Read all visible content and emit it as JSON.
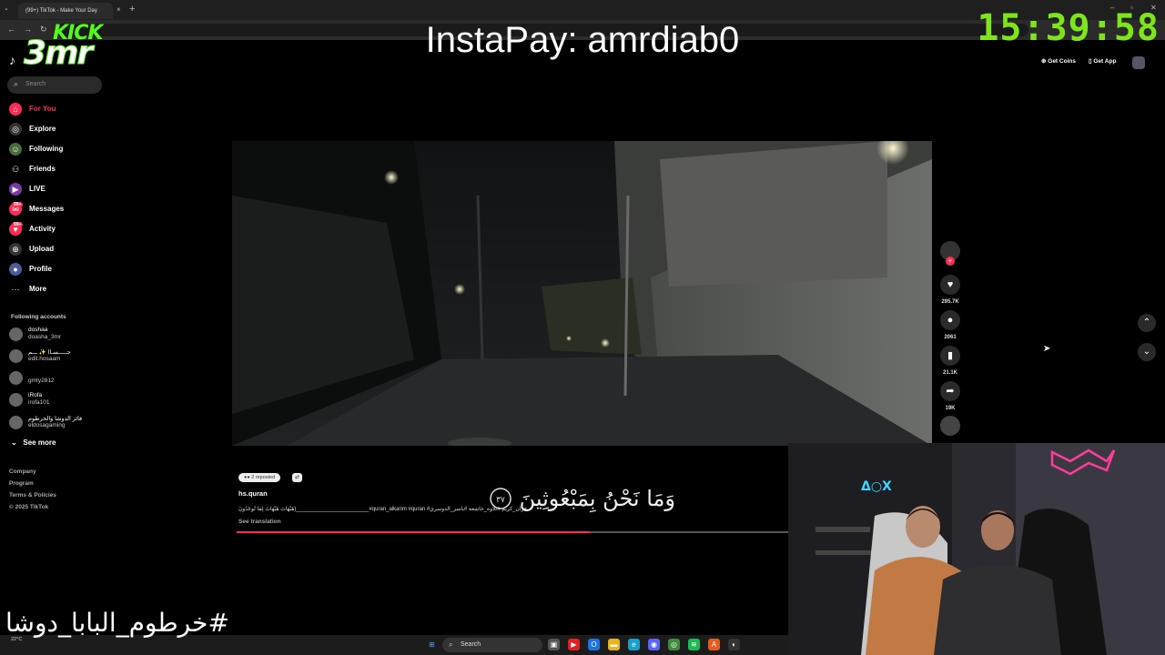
{
  "browser": {
    "tab_title": "(99+) TikTok - Make Your Day",
    "tab_close": "×",
    "new_tab": "+"
  },
  "overlay": {
    "logo_top": "KICK",
    "logo_bottom": "3mr",
    "instapay": "InstaPay: amrdiab0",
    "clock": "15:39:58",
    "hashtag": "#خرطوم_البابا_دوشا"
  },
  "sidebar": {
    "search_placeholder": "Search",
    "nav": [
      {
        "label": "For You",
        "icon": "home-icon",
        "color": "#fe2c55"
      },
      {
        "label": "Explore",
        "icon": "compass-icon",
        "color": "#333333"
      },
      {
        "label": "Following",
        "icon": "following-icon",
        "color": "#4a6b3a"
      },
      {
        "label": "Friends",
        "icon": "friends-icon",
        "color": "#000000"
      },
      {
        "label": "LIVE",
        "icon": "live-icon",
        "color": "#7a3aa0"
      },
      {
        "label": "Messages",
        "icon": "messages-icon",
        "color": "#fe2c55"
      },
      {
        "label": "Activity",
        "icon": "activity-icon",
        "color": "#fe2c55"
      },
      {
        "label": "Upload",
        "icon": "upload-icon",
        "color": "#333333"
      },
      {
        "label": "Profile",
        "icon": "profile-icon",
        "color": "#4d5b9a"
      },
      {
        "label": "More",
        "icon": "more-icon",
        "color": "#000000"
      }
    ],
    "messages_badge": "99+",
    "activity_badge": "99+",
    "following_title": "Following accounts",
    "accounts": [
      {
        "name": "doshaa",
        "user": "doasha_3mr"
      },
      {
        "name": "حـــــسـاا ✨ ـــم",
        "user": "edit.hosaam"
      },
      {
        "name": "",
        "user": "gmty2812"
      },
      {
        "name": "iRofa",
        "user": "irofa101"
      },
      {
        "name": "فائز الدوشا والخرطوم",
        "user": "eldosagaming"
      }
    ],
    "see_more": "See more",
    "footer": [
      "Company",
      "Program",
      "Terms & Policies",
      "© 2025 TikTok"
    ]
  },
  "topright": {
    "get_coins": "Get Coins",
    "get_app": "Get App"
  },
  "actions": {
    "likes": "295.7K",
    "comments": "2061",
    "saves": "21.1K",
    "shares": "19K"
  },
  "video": {
    "reposted": "2 reposted",
    "author": "hs.quran",
    "caption": "‏هَيْهَاتَ هَيْهَاتَ لِمَا تُوعَدُونَ)________________________#quran_alkarim #quran #قرآن_كريم #تلاوة_خاشعة #ياسر_الدوسري",
    "see_translation": "See translation",
    "progress": 0.64,
    "subtitle": "وَمَا نَحْنُ بِمَبْعُوثِينَ",
    "verse_number": "٣٧"
  },
  "taskbar": {
    "search_label": "Search",
    "weather": "22°C"
  },
  "colors": {
    "tiktok_red": "#fe2c55",
    "kick_green": "#53fc18",
    "clock_green": "#7de51a"
  }
}
